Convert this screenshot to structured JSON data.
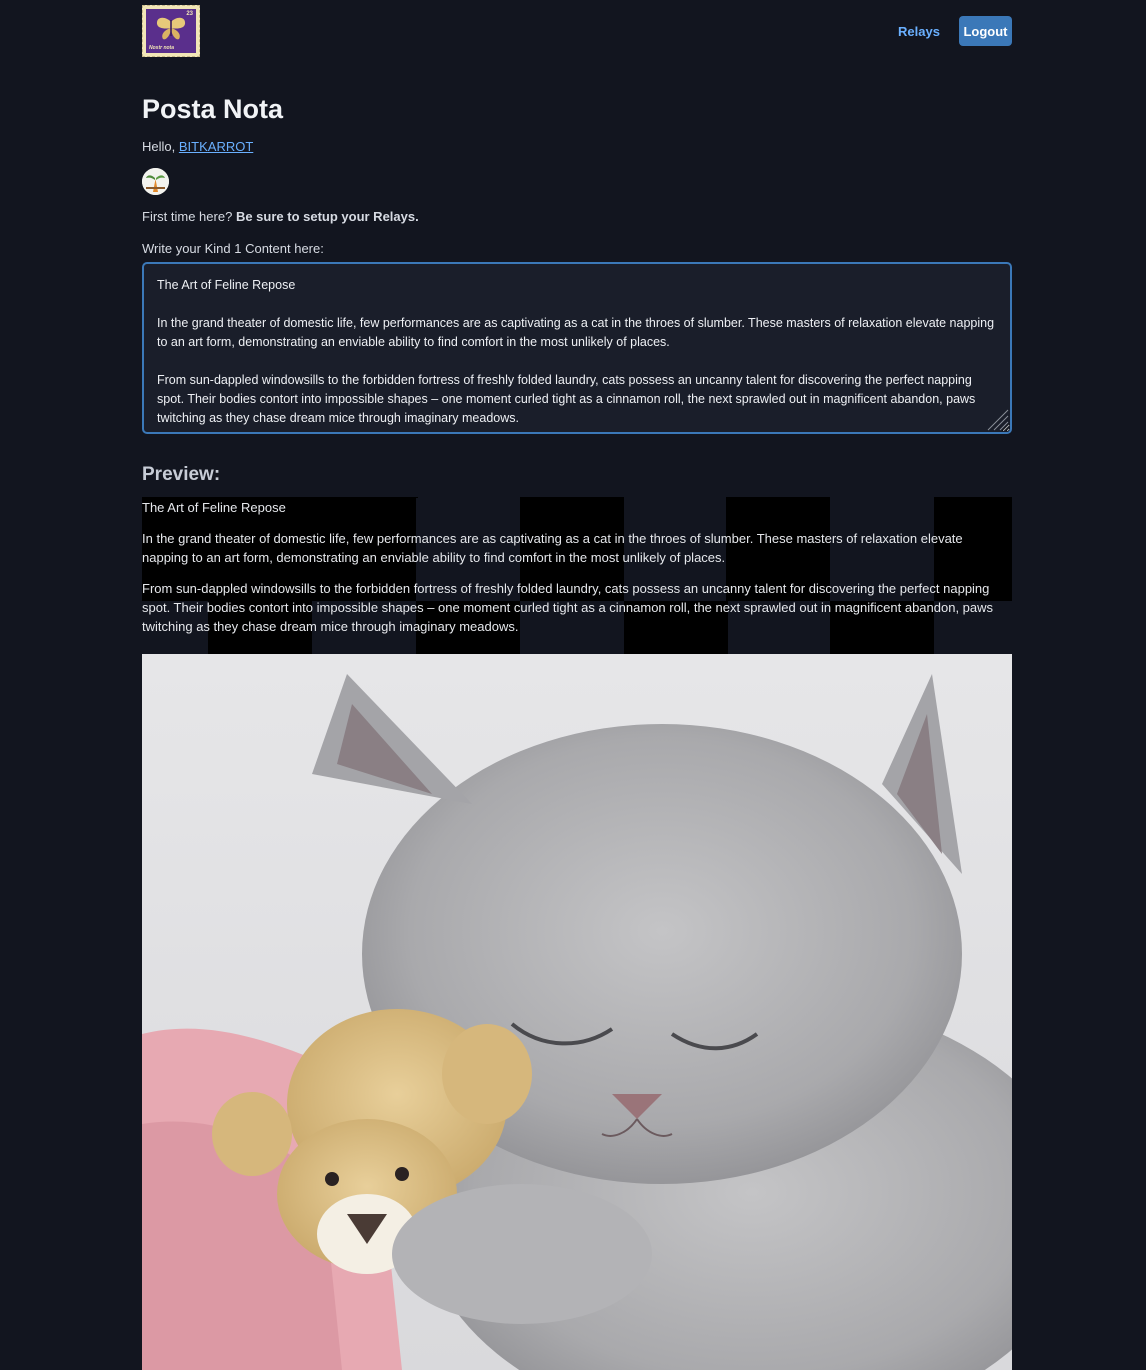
{
  "header": {
    "logo": {
      "denomination": "23",
      "caption": "Nostr nota",
      "icon": "butterfly-stamp-icon",
      "color_stamp": "#5a2f8c"
    },
    "nav": {
      "relays_label": "Relays",
      "logout_label": "Logout"
    }
  },
  "main": {
    "title": "Posta Nota",
    "greeting": "Hello,",
    "username": "BITKARROT",
    "first_time_text": "First time here?",
    "first_time_strong": "Be sure to setup your Relays.",
    "editor_label": "Write your Kind 1 Content here:",
    "editor_value": "The Art of Feline Repose\n\nIn the grand theater of domestic life, few performances are as captivating as a cat in the throes of slumber. These masters of relaxation elevate napping to an art form, demonstrating an enviable ability to find comfort in the most unlikely of places.\n\nFrom sun-dappled windowsills to the forbidden fortress of freshly folded laundry, cats possess an uncanny talent for discovering the perfect napping spot. Their bodies contort into impossible shapes – one moment curled tight as a cinnamon roll, the next sprawled out in magnificent abandon, paws twitching as they chase dream mice through imaginary meadows."
  },
  "preview": {
    "heading": "Preview:",
    "paragraphs": [
      "The Art of Feline Repose",
      "In the grand theater of domestic life, few performances are as captivating as a cat in the throes of slumber. These masters of relaxation elevate napping to an art form, demonstrating an enviable ability to find comfort in the most unlikely of places.",
      "From sun-dappled windowsills to the forbidden fortress of freshly folded laundry, cats possess an uncanny talent for discovering the perfect napping spot. Their bodies contort into impossible shapes – one moment curled tight as a cinnamon roll, the next sprawled out in magnificent abandon, paws twitching as they chase dream mice through imaginary meadows."
    ],
    "image_icon": "sleeping-kitten-with-teddy-bear-image"
  },
  "colors": {
    "background": "#12151f",
    "accent": "#3b78b8",
    "link": "#6ab0ff"
  }
}
